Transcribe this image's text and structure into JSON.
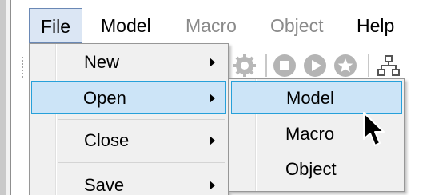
{
  "menubar": {
    "items": [
      {
        "label": "File",
        "state": "open"
      },
      {
        "label": "Model",
        "state": "normal"
      },
      {
        "label": "Macro",
        "state": "disabled"
      },
      {
        "label": "Object",
        "state": "disabled"
      },
      {
        "label": "Help",
        "state": "normal"
      }
    ]
  },
  "toolbar": {
    "icons": [
      "gear-icon",
      "stop-icon",
      "play-icon",
      "star-icon",
      "network-icon"
    ]
  },
  "file_menu": {
    "items": [
      {
        "label": "New",
        "has_submenu": true
      },
      {
        "label": "Open",
        "has_submenu": true,
        "highlighted": true
      },
      {
        "label": "Close",
        "has_submenu": true
      },
      {
        "label": "Save",
        "has_submenu": true
      }
    ]
  },
  "open_submenu": {
    "items": [
      {
        "label": "Model",
        "highlighted": true
      },
      {
        "label": "Macro"
      },
      {
        "label": "Object"
      }
    ]
  },
  "colors": {
    "highlight_fill": "#cce4f7",
    "highlight_border": "#26a0da",
    "menu_background": "#f0f0f0",
    "disabled_text": "#8a8a8a"
  }
}
